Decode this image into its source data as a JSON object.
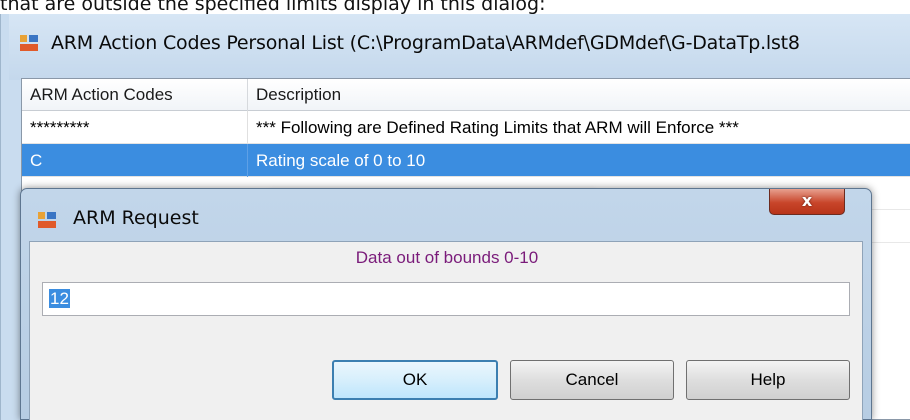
{
  "caption": "that are outside the specified limits display in this dialog:",
  "main_window": {
    "title": "ARM Action Codes Personal List (C:\\ProgramData\\ARMdef\\GDMdef\\G-DataTp.lst8"
  },
  "grid": {
    "columns": [
      "ARM Action Codes",
      "Description"
    ],
    "rows": [
      {
        "code": "*********",
        "description": "*** Following are Defined Rating Limits that ARM will Enforce ***"
      },
      {
        "code": "C",
        "description": "Rating scale of 0 to 10"
      }
    ]
  },
  "dialog": {
    "title": "ARM Request",
    "close_label": "x",
    "message": "Data out of bounds 0-10",
    "input_value": "12",
    "buttons": {
      "ok": "OK",
      "cancel": "Cancel",
      "help": "Help"
    }
  },
  "colors": {
    "selection": "#3b8de0",
    "message_text": "#7a1b7a",
    "close_button": "#c8452a"
  }
}
